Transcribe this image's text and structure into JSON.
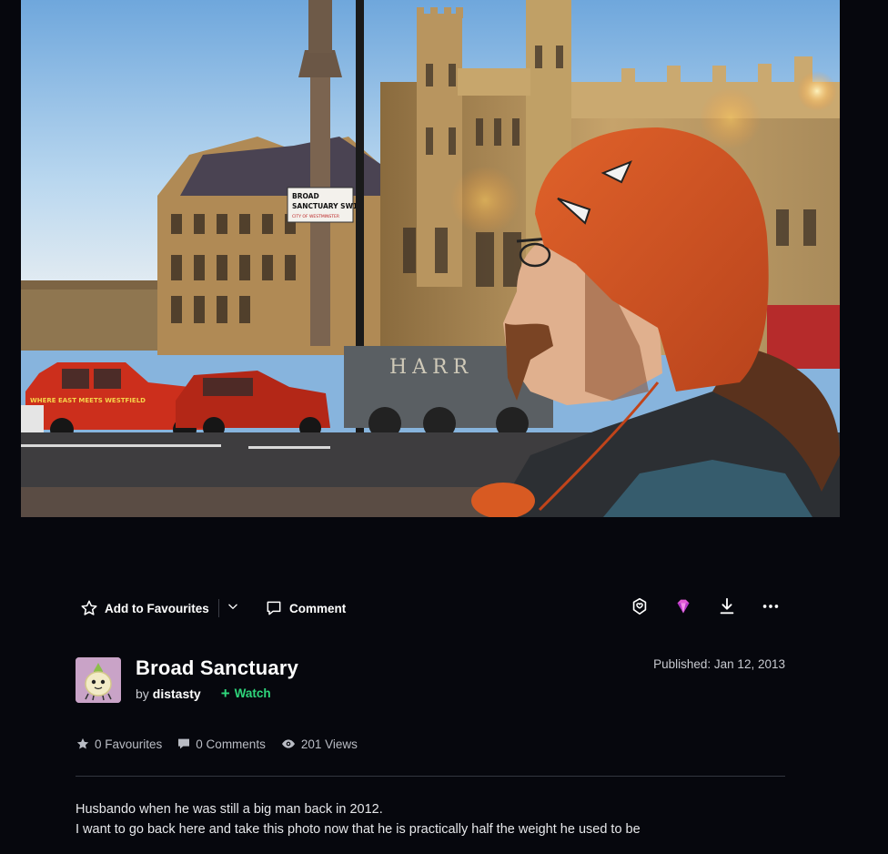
{
  "artwork": {
    "title": "Broad Sanctuary",
    "by_prefix": "by",
    "author": "distasty",
    "watch_label": "Watch",
    "published": "Published: Jan 12, 2013",
    "photo_sign": {
      "line1": "BROAD",
      "line2": "SANCTUARY SW1",
      "line3": "CITY OF WESTMINSTER"
    },
    "photo_truck_text": "HARR",
    "photo_taxi_text": "WHERE EAST MEETS WESTFIELD"
  },
  "actions": {
    "add_to_favourites": "Add to Favourites",
    "comment": "Comment",
    "icons": [
      "star-icon",
      "chevron-down-icon",
      "comment-icon",
      "award-icon",
      "gem-icon",
      "download-icon",
      "more-icon"
    ]
  },
  "stats": {
    "favourites": "0 Favourites",
    "comments": "0 Comments",
    "views": "201 Views"
  },
  "description": {
    "line1": "Husbando when he was still a big man back in 2012.",
    "line2": "I want to go back here and take this photo now that he is practically half the weight he used to be"
  },
  "colors": {
    "background": "#06070d",
    "watch_green": "#2fd67b",
    "gem_pink": "#e25ad6",
    "text_muted": "#c8cad0"
  }
}
